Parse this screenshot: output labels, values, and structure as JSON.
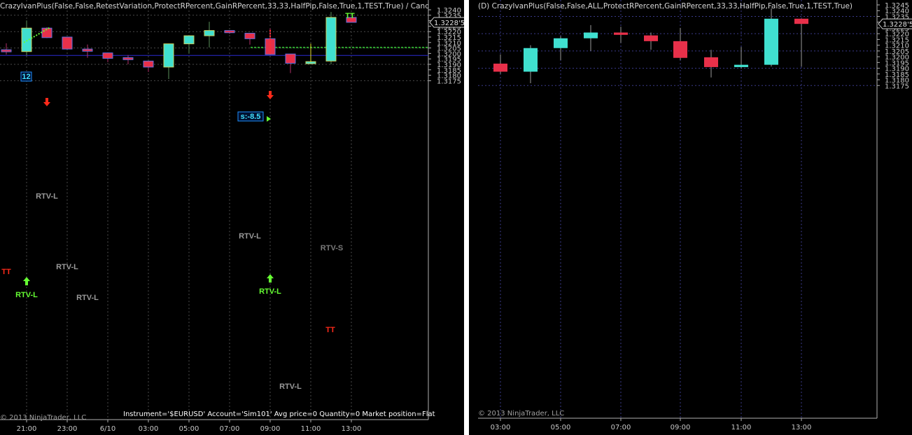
{
  "left_chart": {
    "title": "CrazyIvanPlus(False,False,RetestVariation,ProtectRPercent,GainRPercent,33,33,HalfPip,False,True,1,TEST,True) / Candl",
    "copyright": "© 2013 NinjaTrader, LLC",
    "status": "Instrument='$EURUSD' Account='Sim101' Avg price=0 Quantity=0 Market position=Flat",
    "price_labels": [
      "1.3240",
      "1.3235",
      "1.3230",
      "1.3225",
      "1.3220",
      "1.3215",
      "1.3210",
      "1.3205",
      "1.3200",
      "1.3195",
      "1.3190",
      "1.3185",
      "1.3180",
      "1.3175"
    ],
    "current_price": "1.3228'5",
    "time_labels": [
      "21:00",
      "23:00",
      "6/10",
      "03:00",
      "05:00",
      "07:00",
      "09:00",
      "11:00",
      "13:00"
    ],
    "annotations": {
      "tt_1": "TT",
      "tt_2": "TT",
      "tt_3": "TT",
      "rtv_l_1": "RTV-L",
      "rtv_l_2": "RTV-L",
      "rtv_l_3": "RTV-L",
      "rtv_l_4": "RTV-L",
      "rtv_l_5": "RTV-L",
      "rtv_l_6": "RTV-L",
      "rtv_l_7": "RTV-L",
      "rtv_s": "RTV-S",
      "box_12": "12",
      "box_s": "s:-8.5"
    },
    "candles": [
      {
        "o": 1.32034,
        "h": 1.32093,
        "l": 1.3199,
        "c": 1.32017
      },
      {
        "o": 1.32017,
        "h": 1.32302,
        "l": 1.3198,
        "c": 1.32232
      },
      {
        "o": 1.32232,
        "h": 1.3224,
        "l": 1.3214,
        "c": 1.32145
      },
      {
        "o": 1.3215,
        "h": 1.3215,
        "l": 1.3204,
        "c": 1.3204
      },
      {
        "o": 1.3204,
        "h": 1.32082,
        "l": 1.3196,
        "c": 1.3202
      },
      {
        "o": 1.32005,
        "h": 1.32005,
        "l": 1.3192,
        "c": 1.31955
      },
      {
        "o": 1.31962,
        "h": 1.31985,
        "l": 1.319,
        "c": 1.31955
      },
      {
        "o": 1.3193,
        "h": 1.3193,
        "l": 1.3183,
        "c": 1.31875
      },
      {
        "o": 1.31875,
        "h": 1.3209,
        "l": 1.31765,
        "c": 1.32088
      },
      {
        "o": 1.32088,
        "h": 1.32112,
        "l": 1.32,
        "c": 1.32162
      },
      {
        "o": 1.32088,
        "h": 1.32162,
        "l": 1.32,
        "c": 1.32162
      },
      {
        "o": 1.32162,
        "h": 1.3229,
        "l": 1.32055,
        "c": 1.3221
      },
      {
        "o": 1.3221,
        "h": 1.3221,
        "l": 1.3218,
        "c": 1.3219
      },
      {
        "o": 1.32185,
        "h": 1.32185,
        "l": 1.3208,
        "c": 1.32135
      },
      {
        "o": 1.32135,
        "h": 1.3223,
        "l": 1.31985,
        "c": 1.3199
      },
      {
        "o": 1.31995,
        "h": 1.31995,
        "l": 1.3182,
        "c": 1.3191
      },
      {
        "o": 1.3191,
        "h": 1.31925,
        "l": 1.319,
        "c": 1.31925
      },
      {
        "o": 1.3193,
        "h": 1.3238,
        "l": 1.319,
        "c": 1.3233
      },
      {
        "o": 1.3233,
        "h": 1.3233,
        "l": 1.32285,
        "c": 1.32285
      }
    ]
  },
  "right_chart": {
    "title": "(D) CrazyIvanPlus(False,False,ALL,ProtectRPercent,GainRPercent,33,33,HalfPip,False,True,1,TEST,True)",
    "copyright": "© 2013 NinjaTrader, LLC",
    "price_labels": [
      "1.3245",
      "1.3240",
      "1.3235",
      "1.3230",
      "1.3225",
      "1.3220",
      "1.3215",
      "1.3210",
      "1.3205",
      "1.3200",
      "1.3195",
      "1.3190",
      "1.3185",
      "1.3180",
      "1.3175"
    ],
    "current_price": "1.3228'5",
    "time_labels": [
      "03:00",
      "05:00",
      "07:00",
      "09:00",
      "11:00",
      "13:00"
    ],
    "candles": [
      {
        "o": 1.3194,
        "h": 1.3202,
        "l": 1.3185,
        "c": 1.3187
      },
      {
        "o": 1.3187,
        "h": 1.321,
        "l": 1.3177,
        "c": 1.32075
      },
      {
        "o": 1.32075,
        "h": 1.3218,
        "l": 1.3197,
        "c": 1.3216
      },
      {
        "o": 1.3216,
        "h": 1.32275,
        "l": 1.3205,
        "c": 1.3221
      },
      {
        "o": 1.3221,
        "h": 1.3226,
        "l": 1.3212,
        "c": 1.3219
      },
      {
        "o": 1.32185,
        "h": 1.3221,
        "l": 1.3206,
        "c": 1.32135
      },
      {
        "o": 1.32135,
        "h": 1.3225,
        "l": 1.3197,
        "c": 1.3199
      },
      {
        "o": 1.31995,
        "h": 1.3206,
        "l": 1.3182,
        "c": 1.3191
      },
      {
        "o": 1.3191,
        "h": 1.32085,
        "l": 1.319,
        "c": 1.3193
      },
      {
        "o": 1.3193,
        "h": 1.3242,
        "l": 1.31915,
        "c": 1.3233
      },
      {
        "o": 1.3233,
        "h": 1.3233,
        "l": 1.31915,
        "c": 1.32285
      }
    ]
  },
  "colors": {
    "bull": "#40e0d0",
    "bear": "#e8304a",
    "grid": "#3a3a8a",
    "hline": "#2a2ad0",
    "rtv_green": "#66ff33",
    "label_grey": "#9a9a9a",
    "arrow_red": "#ff2a1a",
    "dotted_green": "#2ea82e",
    "box_blue": "#1e90ff"
  }
}
